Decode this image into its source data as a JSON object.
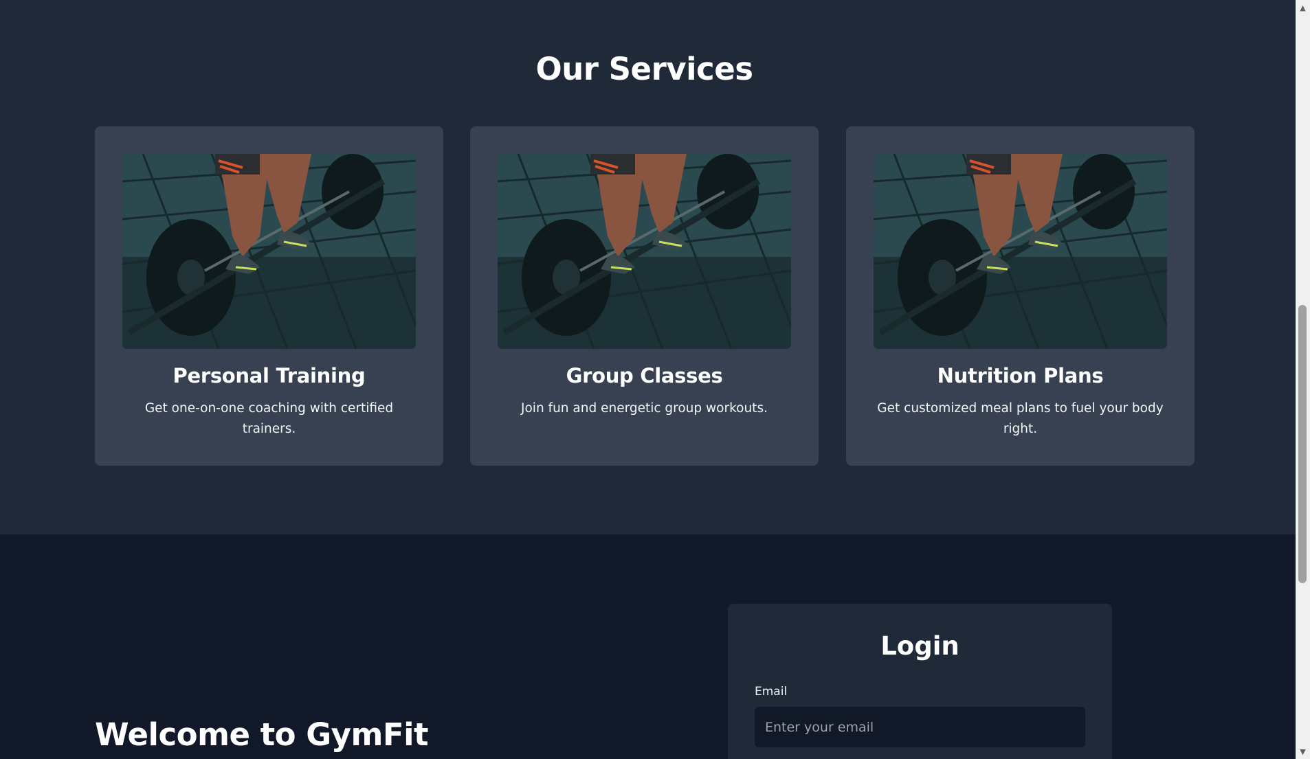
{
  "services": {
    "title": "Our Services",
    "cards": [
      {
        "title": "Personal Training",
        "description": "Get one-on-one coaching with certified trainers.",
        "image": "deadlift-barbell-photo"
      },
      {
        "title": "Group Classes",
        "description": "Join fun and energetic group workouts.",
        "image": "deadlift-barbell-photo"
      },
      {
        "title": "Nutrition Plans",
        "description": "Get customized meal plans to fuel your body right.",
        "image": "deadlift-barbell-photo"
      }
    ]
  },
  "hero": {
    "welcome": "Welcome to GymFit"
  },
  "login": {
    "title": "Login",
    "email_label": "Email",
    "email_placeholder": "Enter your email",
    "email_value": ""
  },
  "scrollbar": {
    "up_icon": "▲",
    "down_icon": "▼"
  },
  "colors": {
    "services_bg": "#1f2937",
    "card_bg": "#374151",
    "hero_bg": "#111827",
    "login_card_bg": "#1f2937",
    "input_bg": "#111827"
  }
}
